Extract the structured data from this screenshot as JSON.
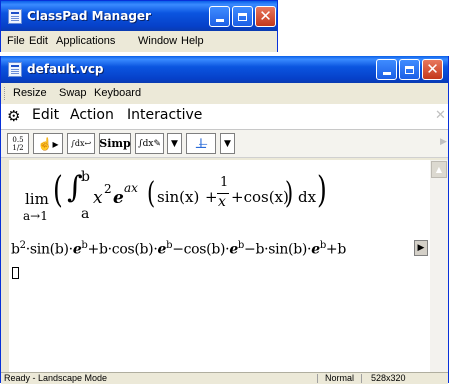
{
  "window_manager": {
    "title": "ClassPad Manager",
    "menu": [
      "File",
      "Edit",
      "Applications",
      "Window",
      "Help"
    ]
  },
  "window_doc": {
    "title": "default.vcp",
    "toolbar": [
      "Resize",
      "Swap",
      "Keyboard"
    ],
    "menu": [
      "Edit",
      "Action",
      "Interactive"
    ],
    "icons": [
      "fraction-decimal-toggle",
      "hand-pointer",
      "integral-toggle",
      "simp",
      "integral-edit",
      "dropdown",
      "graph",
      "dropdown"
    ],
    "simp_label": "Simp",
    "frac_label_top": "0.5",
    "frac_label_bottom": "1/2"
  },
  "math": {
    "lim_text": "lim",
    "lim_sub": "a→1",
    "int_upper": "b",
    "int_lower": "a",
    "x": "x",
    "sq": "2",
    "e": "e",
    "exp": "ax",
    "sin_x": "sin(x)",
    "plus": "+",
    "one": "1",
    "cos_x": "+cos(x)",
    "dx": "dx",
    "result_line": "b²·sin(b)·e^b+b·cos(b)·e^b−cos(b)·e^b−b·sin(b)·e^b+b",
    "r_b": "b",
    "r_2": "2",
    "r_sinb1": "·sin(b)·",
    "r_e": "e",
    "r_b_sup": "b",
    "r_plus_bcos": "+b·cos(b)·",
    "r_minus_cos": "−cos(b)·",
    "r_minus_bsin": "−b·sin(b)·",
    "r_plus_b": "+b"
  },
  "status": {
    "left": "Ready - Landscape Mode",
    "mode": "Normal",
    "resolution": "528x320"
  }
}
